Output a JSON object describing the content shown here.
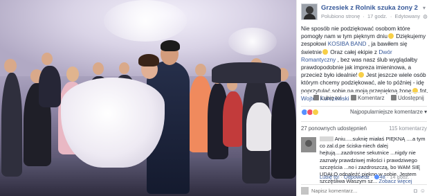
{
  "post": {
    "page_name": "Grzesiek z Rolnik szuka żony 2",
    "meta": {
      "label": "Polubiono stronę",
      "time": "17 godz.",
      "edited": "Edytowany"
    },
    "text": {
      "p1": "Nie sposób nie podziękować osobom które pomogły nam w tym pięknym dniu",
      "p2": " Dziękujemy zespołowi ",
      "band": "KOSIBA BAND",
      "p3": " , ja bawiłem się świetnie",
      "p4": " Oraz całej ekipie z ",
      "venue": "Dwór Romantyczny",
      "p5": " , bez was nasz ślub wyglądałby prawdopodobnie jak impreza imieninowa, a przecież było idealnie!",
      "p6": " Jest jeszcze wiele osób którym chcemy podziękować, ale to później - idę poprzytulać sobie na moją przepiękną żonę",
      "p7": " fot. ",
      "photographer": "Wojtek Kurczewski"
    },
    "actions": {
      "like": "Lubię to!",
      "comment": "Komentarz",
      "share": "Udostępnij"
    },
    "sort_label": "Najpopularniejsze komentarze ▾",
    "shares": "27 ponownych udostępnień",
    "comments_count": "115 komentarzy"
  },
  "comment": {
    "text_a": "Aniu.....suknię miałaś PIĘKNĄ ....a tym co zal.d.pe ściska-niech dalej hejtują....zazdrosne sekutnice ...nigdy nie zaznały prawdziwej miłości i prawdziwego szczęścia ...no i zazdroszczą, bo WAM SIĘ UDAŁO odnaleźć piękno w sobie. Jestem szczęśliwa Waszym sz...",
    "see_more": "Zobacz więcej",
    "like": "Lubię to!",
    "reply": "Odpowiedz",
    "likes": "48",
    "time": "14 godz."
  },
  "composer": {
    "placeholder": "Napisz komentarz..."
  },
  "colors": {
    "link": "#365899",
    "meta": "#90949c",
    "like": "#5890ff",
    "love": "#f25268",
    "haha": "#f7cf48"
  },
  "icons": [
    "avatar",
    "chevron-down-icon",
    "like-icon",
    "comment-icon",
    "share-icon",
    "camera-icon",
    "emoji-icon"
  ]
}
